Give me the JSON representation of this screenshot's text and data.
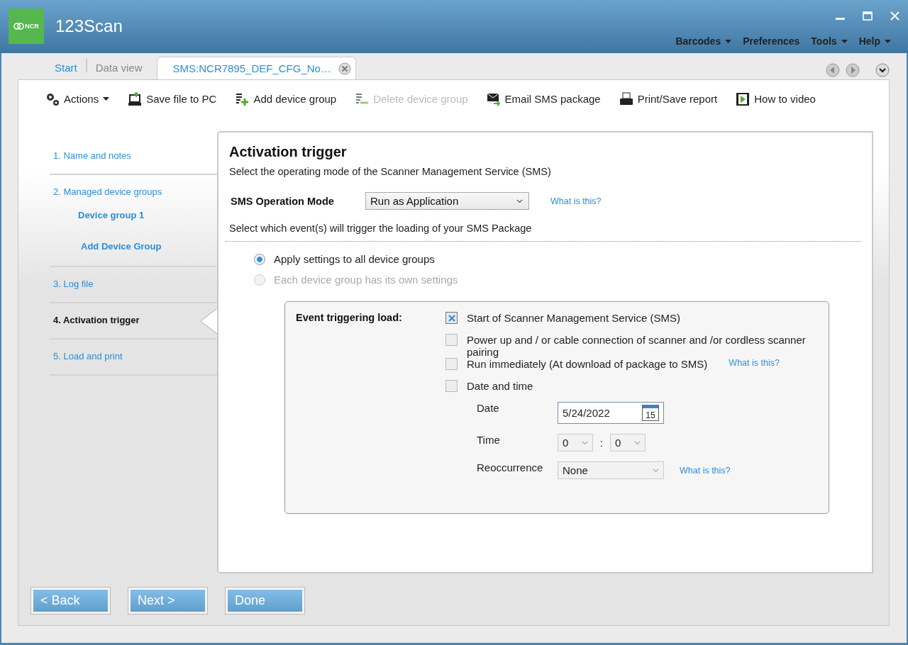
{
  "app": {
    "logo": "NCR",
    "title": "123Scan"
  },
  "menu": [
    {
      "label": "Barcodes",
      "has_menu": true
    },
    {
      "label": "Preferences",
      "has_menu": false
    },
    {
      "label": "Tools",
      "has_menu": true
    },
    {
      "label": "Help",
      "has_menu": true
    }
  ],
  "tabs": [
    {
      "label": "Start",
      "selected": false,
      "closable": false,
      "muted": false
    },
    {
      "label": "Data view",
      "selected": false,
      "closable": false,
      "muted": true
    },
    {
      "label": "SMS:NCR7895_DEF_CFG_No…",
      "selected": true,
      "closable": true,
      "muted": false
    }
  ],
  "toolbar": [
    {
      "kind": "gears",
      "label": "Actions",
      "has_menu": true,
      "disabled": false
    },
    {
      "kind": "save",
      "label": "Save file to PC",
      "has_menu": false,
      "disabled": false
    },
    {
      "kind": "add",
      "label": "Add device group",
      "has_menu": false,
      "disabled": false
    },
    {
      "kind": "delete",
      "label": "Delete device group",
      "has_menu": false,
      "disabled": true
    },
    {
      "kind": "email",
      "label": "Email SMS package",
      "has_menu": false,
      "disabled": false
    },
    {
      "kind": "print",
      "label": "Print/Save report",
      "has_menu": false,
      "disabled": false
    },
    {
      "kind": "video",
      "label": "How to video",
      "has_menu": false,
      "disabled": false
    }
  ],
  "steps": [
    {
      "label": "1. Name and notes",
      "selected": false
    },
    {
      "label": "2. Managed device groups",
      "selected": false,
      "children": [
        {
          "label": "Device group 1"
        },
        {
          "label": "Add Device Group"
        }
      ]
    },
    {
      "label": "3. Log file",
      "selected": false
    },
    {
      "label": "4. Activation trigger",
      "selected": true
    },
    {
      "label": "5. Load and print",
      "selected": false
    }
  ],
  "content": {
    "title": "Activation trigger",
    "subtitle": "Select the operating mode of the Scanner Management Service (SMS)",
    "mode_label": "SMS Operation Mode",
    "mode_value": "Run as Application",
    "mode_help": "What is this?",
    "events_prompt": "Select which event(s) will trigger the loading of your SMS Package",
    "scope": [
      {
        "label": "Apply settings to all device groups",
        "selected": true,
        "disabled": false
      },
      {
        "label": "Each device group has its own settings",
        "selected": false,
        "disabled": true
      }
    ],
    "event_panel": {
      "heading": "Event triggering load:",
      "options": [
        {
          "label": "Start of Scanner Management Service (SMS)",
          "checked": true
        },
        {
          "label": "Power up and / or cable connection of scanner and /or cordless scanner pairing",
          "checked": false
        },
        {
          "label": "Run immediately (At download of package to SMS)",
          "checked": false,
          "help": "What is this?"
        },
        {
          "label": "Date and time",
          "checked": false
        }
      ],
      "date_label": "Date",
      "date_value": "5/24/2022",
      "calendar_day": "15",
      "time_label": "Time",
      "hour": "0",
      "separator": ":",
      "minute": "0",
      "time_disabled": true,
      "reoccurrence_label": "Reoccurrence",
      "reoccurrence_value": "None",
      "reoccurrence_disabled": true,
      "reoccurrence_help": "What is this?"
    }
  },
  "buttons": [
    "< Back",
    "Next >",
    "Done"
  ]
}
